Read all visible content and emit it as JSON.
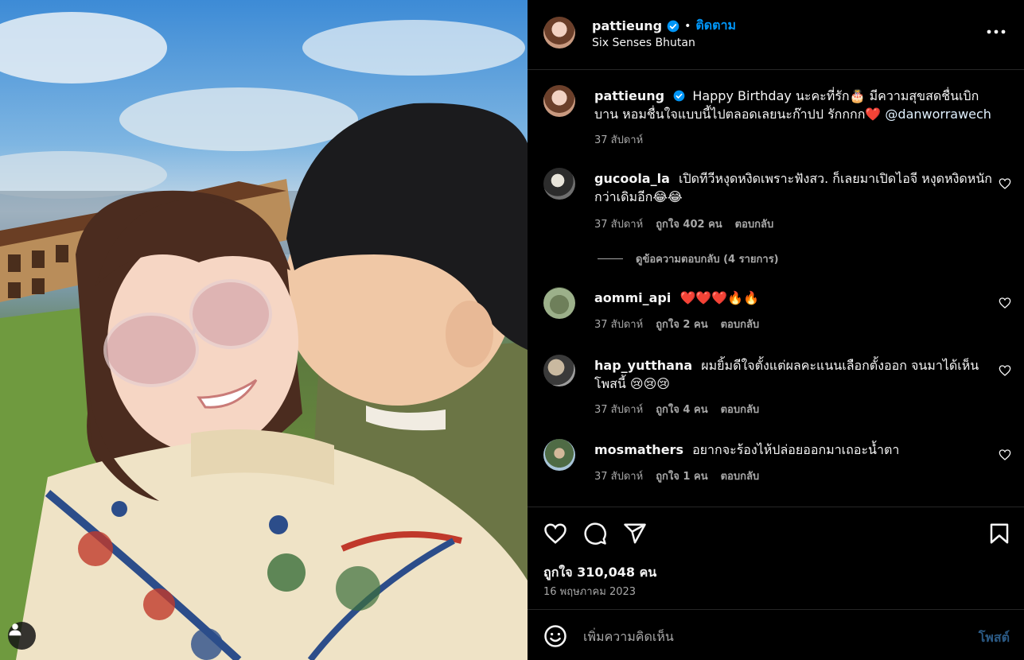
{
  "post": {
    "username": "pattieung",
    "follow_label": "ติดตาม",
    "location": "Six Senses Bhutan",
    "caption": {
      "username": "pattieung",
      "text_before": "Happy Birthday นะคะที่รัก🎂 มีความสุขสดชื่นเบิกบาน หอมชื่นใจแบบนี้ไปตลอดเลยนะก๊าปป รักกกก❤️",
      "mention": "@danworrawech",
      "time": "37 สัปดาห์"
    },
    "likes_text": "ถูกใจ 310,048 คน",
    "date": "16 พฤษภาคม 2023"
  },
  "comments": [
    {
      "username": "gucoola_la",
      "text": "เปิดทีวีหงุดหงิดเพราะฟังสว. ก็เลยมาเปิดไอจี หงุดหงิดหนักกว่าเดิมอีก😂😂",
      "time": "37 สัปดาห์",
      "likes": "ถูกใจ 402 คน",
      "reply": "ตอบกลับ",
      "view_replies": "ดูข้อความตอบกลับ (4 รายการ)"
    },
    {
      "username": "aommi_api",
      "text": "❤️❤️❤️🔥🔥",
      "time": "37 สัปดาห์",
      "likes": "ถูกใจ 2 คน",
      "reply": "ตอบกลับ"
    },
    {
      "username": "hap_yutthana",
      "text": "ผมยิ้มดีใจตั้งแต่ผลคะแนนเลือกตั้งออก จนมาได้เห็นโพสนี้ 😢😢😢",
      "time": "37 สัปดาห์",
      "likes": "ถูกใจ 4 คน",
      "reply": "ตอบกลับ"
    },
    {
      "username": "mosmathers",
      "text": "อยากจะร้องไห้ปล่อยออกมาเถอะน้ำตา",
      "time": "37 สัปดาห์",
      "likes": "ถูกใจ 1 คน",
      "reply": "ตอบกลับ"
    }
  ],
  "add_comment": {
    "placeholder": "เพิ่มความคิดเห็น",
    "post_label": "โพสต์"
  },
  "icons": {
    "verified": "verified-badge-icon",
    "more": "more-options-icon",
    "like": "heart-icon",
    "comment": "comment-icon",
    "share": "share-icon",
    "save": "bookmark-icon",
    "emoji": "emoji-icon",
    "tag": "user-tag-icon"
  },
  "colors": {
    "background": "#000000",
    "accent": "#0095f6",
    "muted": "#a8a8a8",
    "heart": "#ff3040"
  }
}
